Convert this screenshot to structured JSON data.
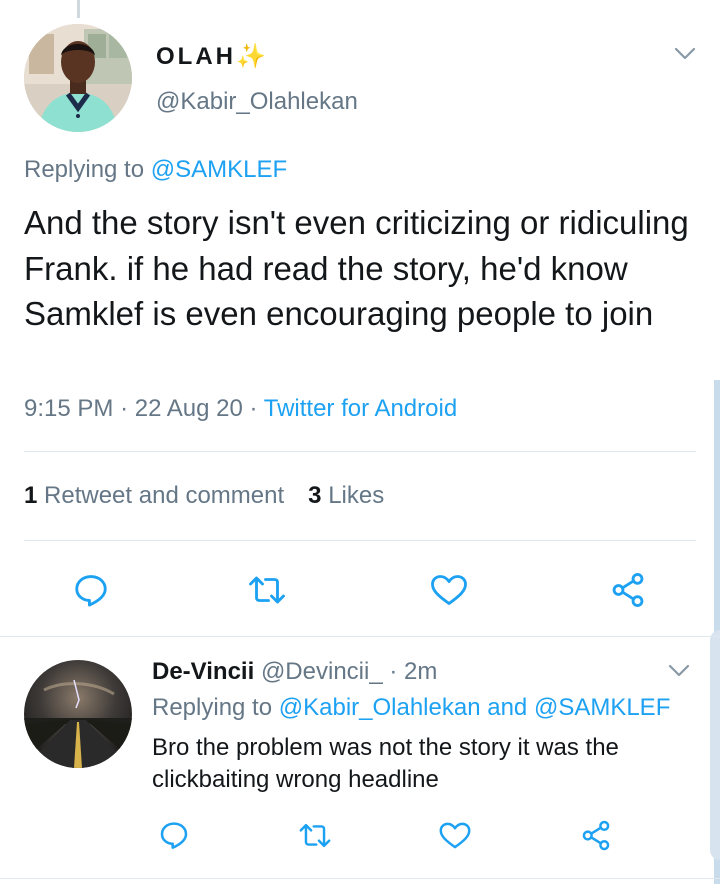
{
  "main_tweet": {
    "author_name": "OLAH",
    "author_emoji": "✨",
    "handle": "@Kabir_Olahlekan",
    "replying_prefix": "Replying to",
    "replying_to": "@SAMKLEF",
    "text": "And the story isn't even criticizing or ridiculing Frank. if he had read the story, he'd know Samklef is even encouraging people to join",
    "time": "9:15 PM",
    "date": "22 Aug 20",
    "source": "Twitter for Android",
    "retweet_count": "1",
    "retweet_label": "Retweet and comment",
    "like_count": "3",
    "like_label": "Likes"
  },
  "reply_tweet": {
    "author_name": "De-Vincii",
    "handle": "@Devincii_",
    "time": "2m",
    "replying_prefix": "Replying to",
    "replying_to_1": "@Kabir_Olahlekan",
    "replying_and": "and",
    "replying_to_2": "@SAMKLEF",
    "text": "Bro the problem was not the story it was the clickbaiting wrong headline"
  },
  "icons": {
    "reply": "comment-bubble-icon",
    "retweet": "retweet-icon",
    "like": "heart-icon",
    "share": "share-icon",
    "menu": "chevron-down-icon"
  },
  "colors": {
    "link": "#1da1f2",
    "secondary_text": "#657786",
    "primary_text": "#14171a",
    "divider": "#e1e8ed"
  }
}
